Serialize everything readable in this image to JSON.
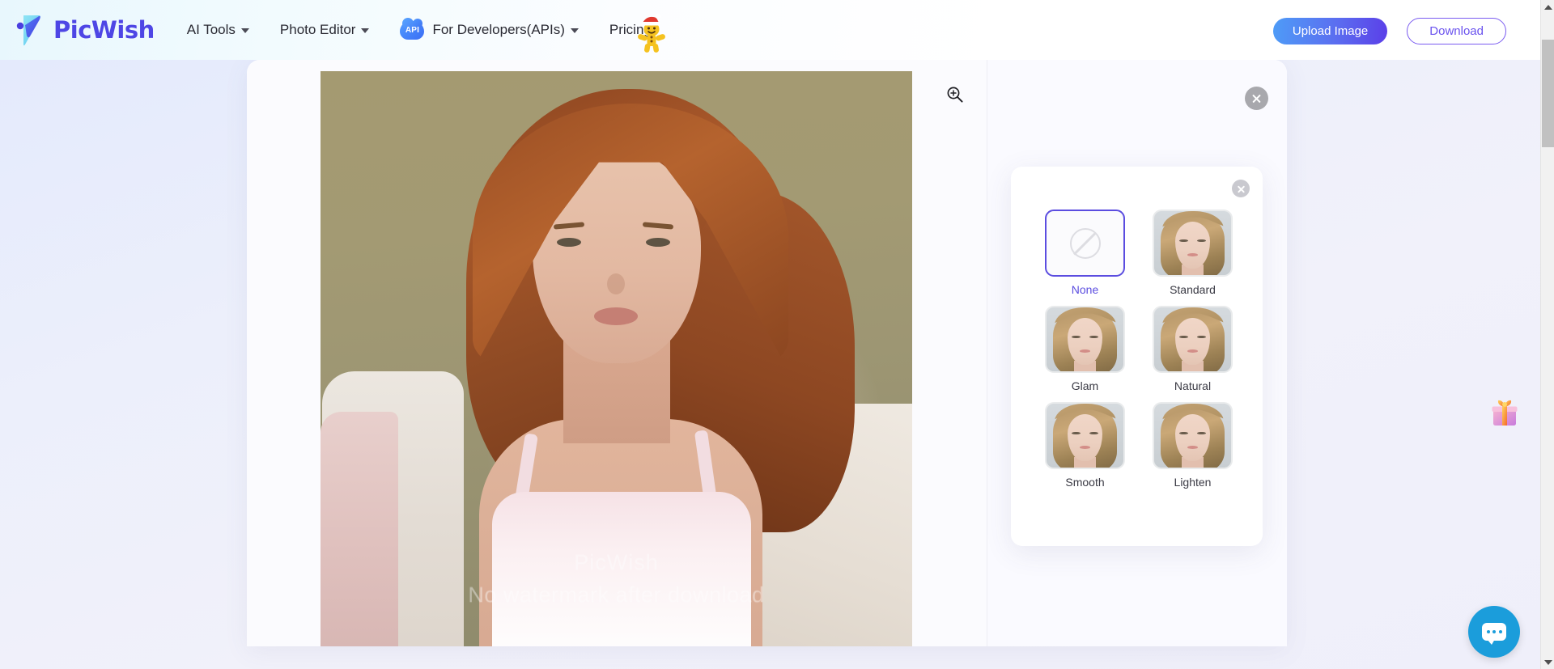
{
  "header": {
    "brand": "PicWish",
    "logo_icon": "picwish-logo-icon",
    "nav": [
      {
        "label": "AI Tools",
        "has_dropdown": true,
        "icon": null
      },
      {
        "label": "Photo Editor",
        "has_dropdown": true,
        "icon": null
      },
      {
        "label": "For Developers(APIs)",
        "has_dropdown": true,
        "icon": "api-cloud-badge",
        "badge_text": "API"
      },
      {
        "label": "Pricing",
        "has_dropdown": false,
        "icon": null
      }
    ],
    "promo_icon": "gingerbread-man-santa-hat-icon",
    "promo_glyph": "🍪",
    "upload_label": "Upload Image",
    "download_label": "Download"
  },
  "canvas": {
    "zoom_icon": "zoom-in-magnifier-icon",
    "watermark_line1": "PicWish",
    "watermark_line2": "No watermark after download"
  },
  "right_pane": {
    "close_icon": "close-icon"
  },
  "retouch_panel": {
    "close_icon": "close-icon",
    "styles": [
      {
        "label": "None",
        "selected": true,
        "thumb": "no-style-slash-icon"
      },
      {
        "label": "Standard",
        "selected": false,
        "thumb": "face-thumbnail"
      },
      {
        "label": "Glam",
        "selected": false,
        "thumb": "face-thumbnail"
      },
      {
        "label": "Natural",
        "selected": false,
        "thumb": "face-thumbnail"
      },
      {
        "label": "Smooth",
        "selected": false,
        "thumb": "face-thumbnail"
      },
      {
        "label": "Lighten",
        "selected": false,
        "thumb": "face-thumbnail"
      }
    ]
  },
  "floating": {
    "gift_icon": "gift-box-icon",
    "gift_glyph": "🎁",
    "chat_icon": "chat-bubble-icon"
  },
  "scrollbar": {
    "up_icon": "scroll-up-arrow-icon",
    "down_icon": "scroll-down-arrow-icon"
  },
  "colors": {
    "brand_purple": "#4e46e5",
    "accent_blue": "#4e9cf7",
    "selected_border": "#5b4de0",
    "chat_blue": "#1b9ddb",
    "page_bg": "#eceffb"
  }
}
